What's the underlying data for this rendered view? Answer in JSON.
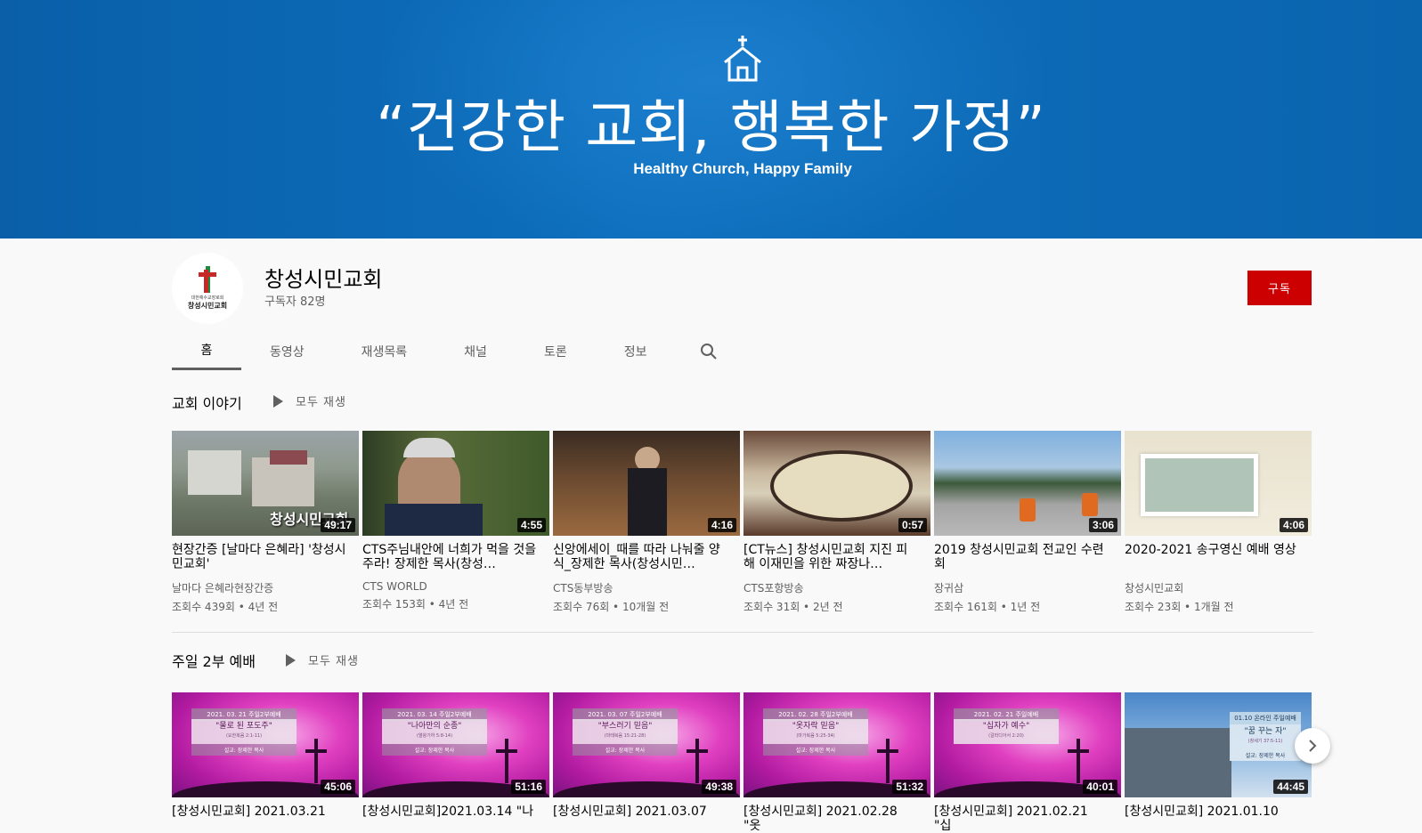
{
  "banner": {
    "slogan": "“건강한 교회, 행복한 가정”",
    "subtitle": "Healthy Church, Happy Family"
  },
  "channel": {
    "name": "창성시민교회",
    "subscribers": "구독자 82명",
    "subscribe_label": "구독",
    "avatar_tiny": "대한예수교장로회",
    "avatar_name": "창성시민교회"
  },
  "tabs": [
    {
      "label": "홈",
      "active": true
    },
    {
      "label": "동영상"
    },
    {
      "label": "재생목록"
    },
    {
      "label": "채널"
    },
    {
      "label": "토론"
    },
    {
      "label": "정보"
    }
  ],
  "shelves": [
    {
      "title": "교회 이야기",
      "play_all": "모두 재생",
      "videos": [
        {
          "title": "현장간증 [날마다 은혜라] '창성시민교회'",
          "duration": "49:17",
          "channel": "날마다 은혜라현장간증",
          "meta": "조회수 439회 • 4년 전",
          "overlay": "창성시민교회"
        },
        {
          "title": "CTS주님내안에 너희가 먹을 것을 주라! 장제한 목사(창성…",
          "duration": "4:55",
          "channel": "CTS WORLD",
          "meta": "조회수 153회 • 4년 전"
        },
        {
          "title": "신앙에세이_때를 따라 나눠줄 양식_장제한 목사(창성시민…",
          "duration": "4:16",
          "channel": "CTS동부방송",
          "meta": "조회수 76회 • 10개월 전"
        },
        {
          "title": "[CT뉴스] 창성시민교회 지진 피해 이재민을 위한 짜장나…",
          "duration": "0:57",
          "channel": "CTS포항방송",
          "meta": "조회수 31회 • 2년 전"
        },
        {
          "title": "2019 창성시민교회 전교인 수련회",
          "duration": "3:06",
          "channel": "장귀삼",
          "meta": "조회수 161회 • 1년 전"
        },
        {
          "title": "2020-2021 송구영신 예배 영상",
          "duration": "4:06",
          "channel": "창성시민교회",
          "meta": "조회수 23회 • 1개월 전"
        }
      ]
    },
    {
      "title": "주일 2부 예배",
      "play_all": "모두 재생",
      "videos": [
        {
          "title": "[창성시민교회] 2021.03.21",
          "duration": "45:06",
          "tag": "2021. 03. 21 주일2부예배",
          "sermon": "\"물로 된 포도주\"",
          "ref": "(요한복음 2:1-11)",
          "pastor": "설교: 장제한 목사"
        },
        {
          "title": "[창성시민교회]2021.03.14 \"나",
          "duration": "51:16",
          "tag": "2021. 03. 14 주일2부예배",
          "sermon": "\"나아만의 순종\"",
          "ref": "(열왕기하 5:8-14)",
          "pastor": "설교: 장제한 목사"
        },
        {
          "title": "[창성시민교회] 2021.03.07",
          "duration": "49:38",
          "tag": "2021. 03. 07 주일2부예배",
          "sermon": "\"부스러기 믿음\"",
          "ref": "(마태복음 15:21-28)",
          "pastor": "설교: 장제한 목사"
        },
        {
          "title": "[창성시민교회] 2021.02.28 \"옷",
          "duration": "51:32",
          "tag": "2021. 02. 28 주일2부예배",
          "sermon": "\"옷자락 믿음\"",
          "ref": "(마가복음 5:25-34)",
          "pastor": "설교: 장제한 목사"
        },
        {
          "title": "[창성시민교회] 2021.02.21 \"십",
          "duration": "40:01",
          "tag": "2021. 02. 21 주일예배",
          "sermon": "\"십자가 예수\"",
          "ref": "(갈라디아서 2:20)",
          "pastor": "설교: 장제한 목사"
        },
        {
          "title": "[창성시민교회] 2021.01.10",
          "duration": "44:45",
          "tag": "01.10 온라인 주일예배",
          "sermon": "\"꿈 꾸는 자\"",
          "ref": "(창세기 37:5-11)",
          "pastor": "설교: 장제한 목사"
        }
      ]
    }
  ]
}
